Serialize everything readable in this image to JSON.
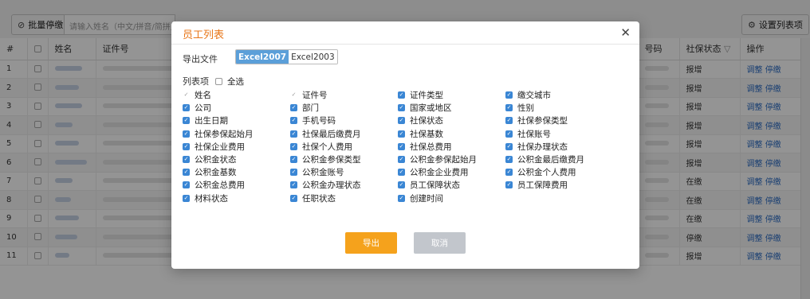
{
  "toolbar": {
    "batch_stop_label": "批量停缴",
    "search_placeholder": "请输入姓名（中文/拼音/简拼）",
    "settings_label": "设置列表项"
  },
  "table": {
    "headers": [
      "#",
      "",
      "姓名",
      "证件号",
      "号码",
      "社保状态",
      "操作"
    ],
    "row_numbers": [
      "1",
      "2",
      "3",
      "4",
      "5",
      "6",
      "7",
      "8",
      "9",
      "10",
      "11"
    ],
    "statuses": [
      "报增",
      "报增",
      "报增",
      "报增",
      "报增",
      "报增",
      "在缴",
      "在缴",
      "在缴",
      "停缴",
      "报增"
    ],
    "action_adjust": "调整",
    "action_stop": "停缴"
  },
  "modal": {
    "title": "员工列表",
    "export_file_label": "导出文件",
    "format_options": [
      "Excel2007",
      "Excel2003"
    ],
    "selected_format": "Excel2007",
    "column_items_label": "列表项",
    "select_all_label": "全选",
    "export_button": "导出",
    "cancel_button": "取消",
    "columns": [
      {
        "label": "姓名",
        "state": "disabled"
      },
      {
        "label": "证件号",
        "state": "disabled"
      },
      {
        "label": "证件类型",
        "state": "checked"
      },
      {
        "label": "缴交城市",
        "state": "checked"
      },
      {
        "label": "公司",
        "state": "checked"
      },
      {
        "label": "部门",
        "state": "checked"
      },
      {
        "label": "国家或地区",
        "state": "checked"
      },
      {
        "label": "性别",
        "state": "checked"
      },
      {
        "label": "出生日期",
        "state": "checked"
      },
      {
        "label": "手机号码",
        "state": "checked"
      },
      {
        "label": "社保状态",
        "state": "checked"
      },
      {
        "label": "社保参保类型",
        "state": "checked"
      },
      {
        "label": "社保参保起始月",
        "state": "checked"
      },
      {
        "label": "社保最后缴费月",
        "state": "checked"
      },
      {
        "label": "社保基数",
        "state": "checked"
      },
      {
        "label": "社保账号",
        "state": "checked"
      },
      {
        "label": "社保企业费用",
        "state": "checked"
      },
      {
        "label": "社保个人费用",
        "state": "checked"
      },
      {
        "label": "社保总费用",
        "state": "checked"
      },
      {
        "label": "社保办理状态",
        "state": "checked"
      },
      {
        "label": "公积金状态",
        "state": "checked"
      },
      {
        "label": "公积金参保类型",
        "state": "checked"
      },
      {
        "label": "公积金参保起始月",
        "state": "checked"
      },
      {
        "label": "公积金最后缴费月",
        "state": "checked"
      },
      {
        "label": "公积金基数",
        "state": "checked"
      },
      {
        "label": "公积金账号",
        "state": "checked"
      },
      {
        "label": "公积金企业费用",
        "state": "checked"
      },
      {
        "label": "公积金个人费用",
        "state": "checked"
      },
      {
        "label": "公积金总费用",
        "state": "checked"
      },
      {
        "label": "公积金办理状态",
        "state": "checked"
      },
      {
        "label": "员工保障状态",
        "state": "checked"
      },
      {
        "label": "员工保障费用",
        "state": "checked"
      },
      {
        "label": "材料状态",
        "state": "checked"
      },
      {
        "label": "任职状态",
        "state": "checked"
      },
      {
        "label": "创建时间",
        "state": "checked"
      }
    ]
  }
}
